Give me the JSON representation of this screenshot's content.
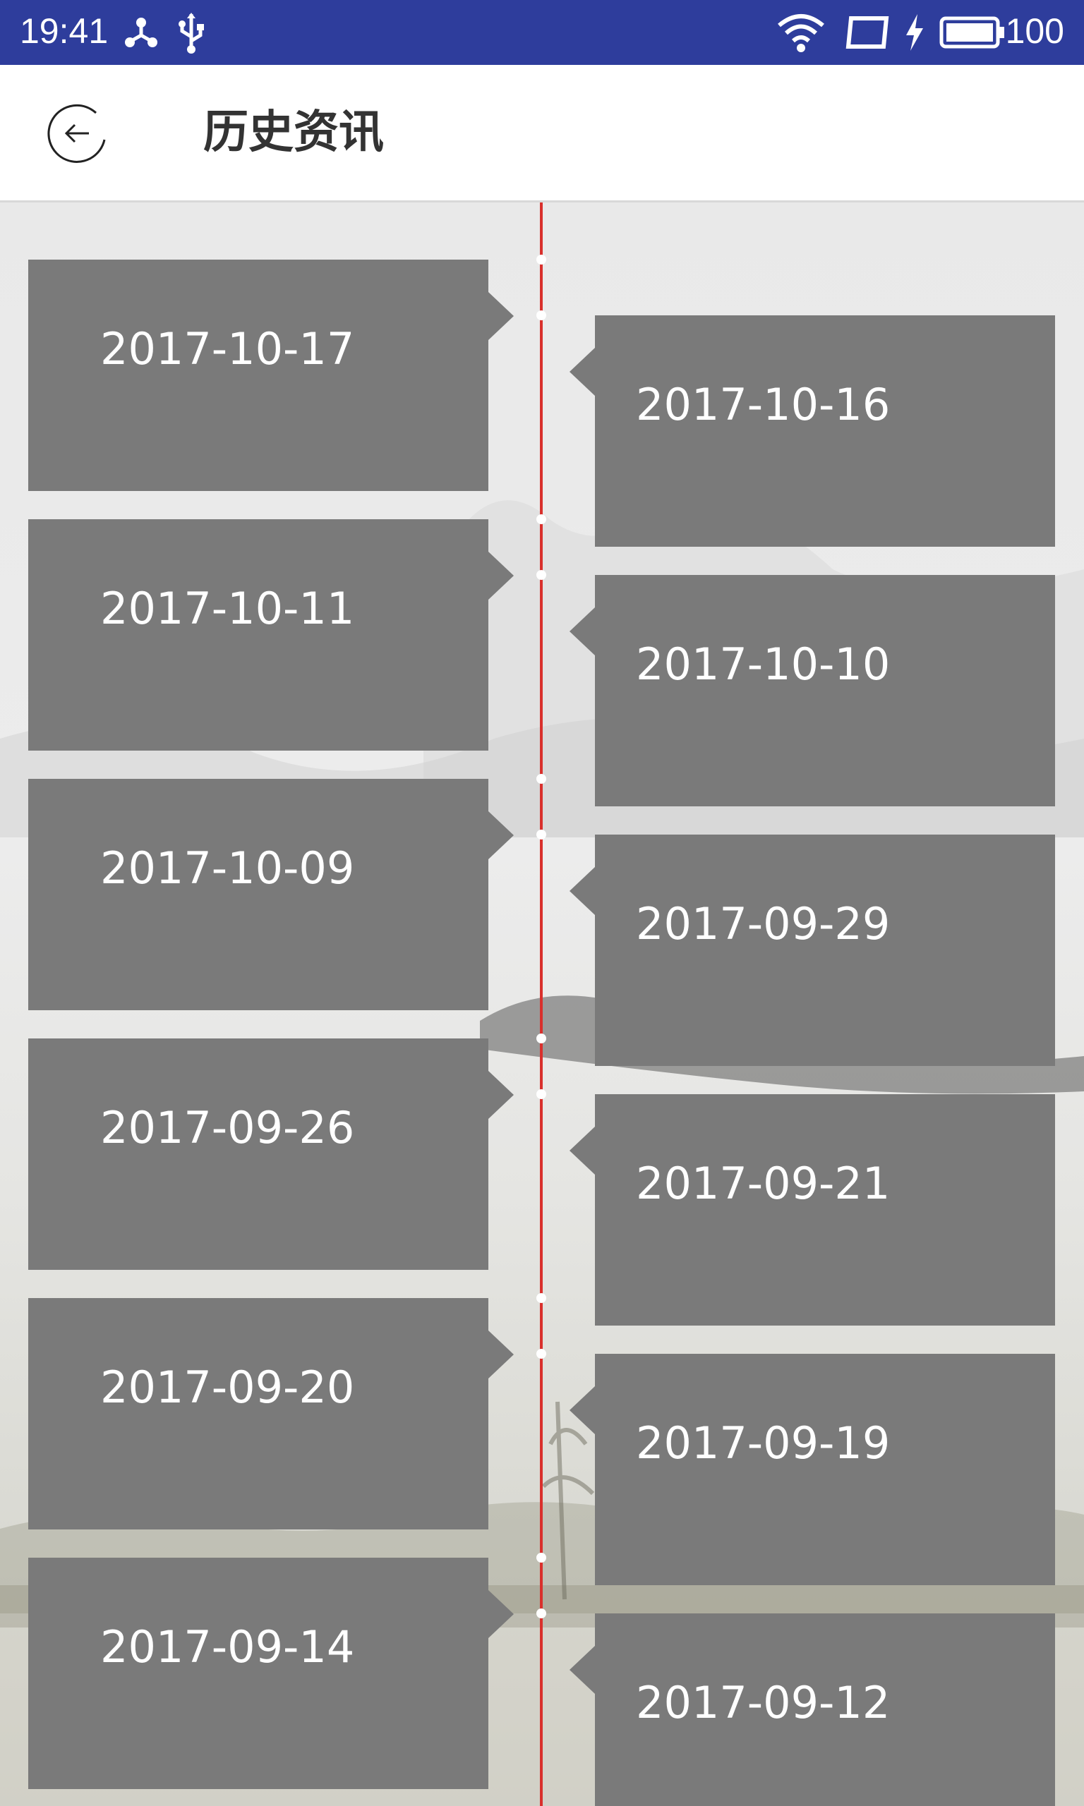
{
  "status_bar": {
    "time": "19:41",
    "battery": "100",
    "icons": [
      "share-nodes-icon",
      "usb-icon",
      "wifi-icon",
      "screen-rotation-icon",
      "charging-bolt-icon",
      "battery-icon"
    ]
  },
  "header": {
    "back_icon": "back-arrow-icon",
    "title": "历史资讯"
  },
  "colors": {
    "status_bar": "#2e3d9c",
    "timeline": "#d9302c",
    "card": "#7a7a7a",
    "card_text": "#ffffff"
  },
  "timeline": {
    "left": [
      "2017-10-17",
      "2017-10-11",
      "2017-10-09",
      "2017-09-26",
      "2017-09-20",
      "2017-09-14"
    ],
    "right": [
      "2017-10-16",
      "2017-10-10",
      "2017-09-29",
      "2017-09-21",
      "2017-09-19",
      "2017-09-12"
    ]
  }
}
